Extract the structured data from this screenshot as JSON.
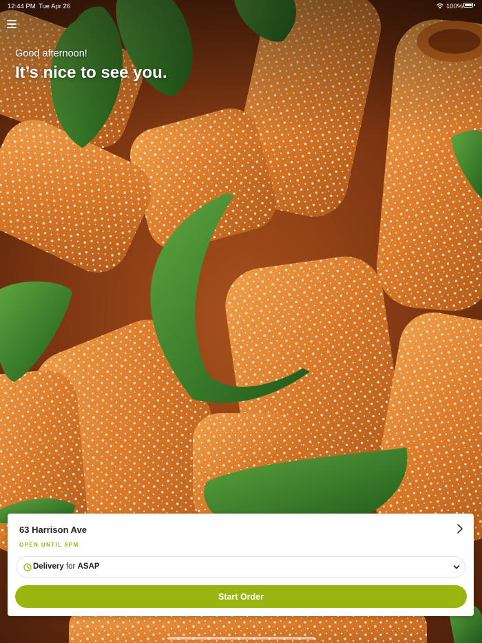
{
  "status_bar": {
    "time": "12:44 PM",
    "date": "Tue Apr 26",
    "battery": "100%",
    "wifi_icon": "wifi-icon",
    "battery_icon": "battery-icon"
  },
  "header": {
    "menu_icon": "hamburger-menu-icon",
    "greeting": "Good afternoon!",
    "welcome": "It’s nice to see you."
  },
  "hero": {
    "description_icon": "pasta-background-image"
  },
  "location_card": {
    "name": "63 Harrison Ave",
    "hours_status": "OPEN UNTIL 8PM",
    "chevron_icon": "chevron-right-icon",
    "order_mode": {
      "type": "Delivery",
      "connector": "for",
      "time": "ASAP",
      "clock_icon": "clock-icon",
      "dropdown_icon": "chevron-down-icon"
    },
    "start_button_label": "Start Order"
  },
  "colors": {
    "accent": "#9ab50f",
    "open_status": "#94b40a"
  }
}
